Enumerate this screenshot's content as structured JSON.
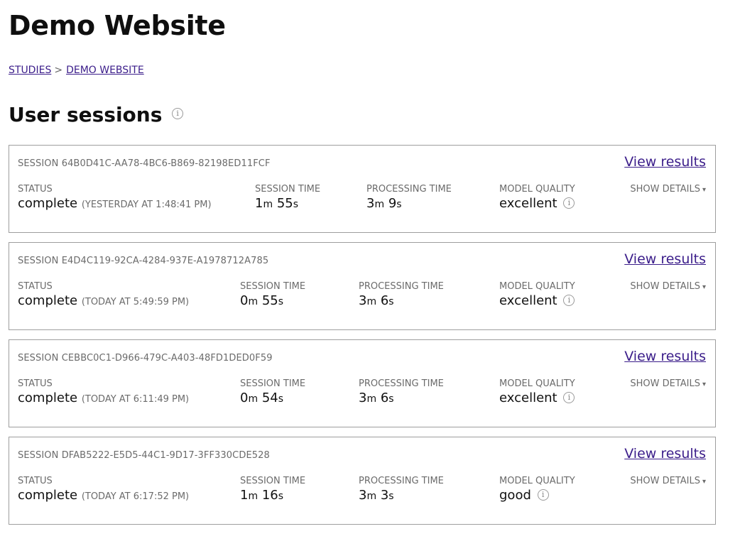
{
  "site": {
    "title": "Demo Website"
  },
  "breadcrumb": {
    "items": [
      "STUDIES",
      "DEMO WEBSITE"
    ],
    "separator": ">"
  },
  "section": {
    "title": "User sessions",
    "info_icon": "info-icon"
  },
  "labels": {
    "status": "STATUS",
    "session_time": "SESSION TIME",
    "processing_time": "PROCESSING TIME",
    "model_quality": "MODEL QUALITY",
    "show_details": "SHOW DETAILS",
    "show_details_caret": "▾",
    "view_results": "View results",
    "minutes_unit": "m",
    "seconds_unit": "s"
  },
  "colors": {
    "link": "#3b1d8a",
    "label": "#6b6b6b",
    "border": "#9e9e9e"
  },
  "sessions": [
    {
      "id": "SESSION 64B0D41C-AA78-4BC6-B869-82198ED11FCF",
      "status": "complete",
      "status_time": "(YESTERDAY AT 1:48:41 PM)",
      "session_min": "1",
      "session_sec": "55",
      "processing_min": "3",
      "processing_sec": "9",
      "quality": "excellent"
    },
    {
      "id": "SESSION E4D4C119-92CA-4284-937E-A1978712A785",
      "status": "complete",
      "status_time": "(TODAY AT 5:49:59 PM)",
      "session_min": "0",
      "session_sec": "55",
      "processing_min": "3",
      "processing_sec": "6",
      "quality": "excellent"
    },
    {
      "id": "SESSION CEBBC0C1-D966-479C-A403-48FD1DED0F59",
      "status": "complete",
      "status_time": "(TODAY AT 6:11:49 PM)",
      "session_min": "0",
      "session_sec": "54",
      "processing_min": "3",
      "processing_sec": "6",
      "quality": "excellent"
    },
    {
      "id": "SESSION DFAB5222-E5D5-44C1-9D17-3FF330CDE528",
      "status": "complete",
      "status_time": "(TODAY AT 6:17:52 PM)",
      "session_min": "1",
      "session_sec": "16",
      "processing_min": "3",
      "processing_sec": "3",
      "quality": "good"
    }
  ]
}
